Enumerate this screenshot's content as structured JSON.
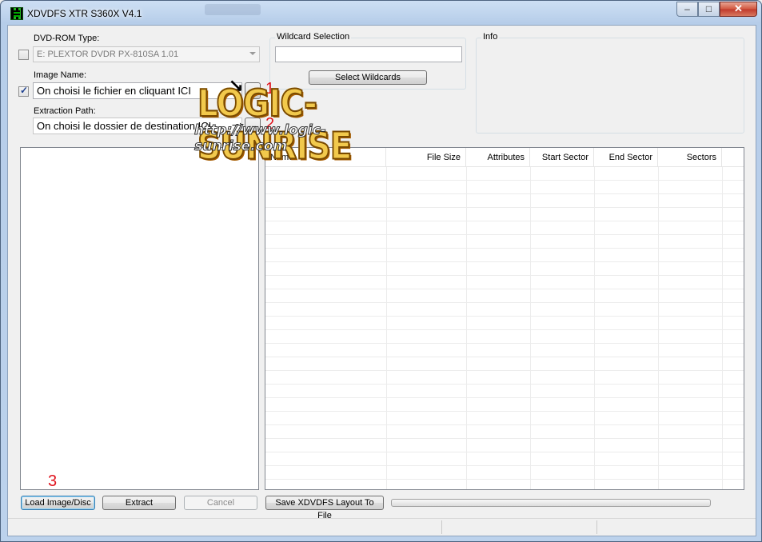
{
  "window": {
    "title": "XDVDFS XTR S360X V4.1",
    "controls": {
      "minimize": "–",
      "maximize": "□",
      "close": "✕"
    }
  },
  "dvd": {
    "label": "DVD-ROM Type:",
    "checked": false,
    "selected": "E: PLEXTOR DVDR PX-810SA 1.01"
  },
  "image": {
    "label": "Image Name:",
    "checked": true,
    "value": "On choisi le fichier en cliquant ICI",
    "browse_label": "..."
  },
  "extraction": {
    "label": "Extraction Path:",
    "value": "On choisi le dossier de destination ICI",
    "browse_label": "..."
  },
  "wildcard": {
    "title": "Wildcard Selection",
    "value": "",
    "button": "Select Wildcards"
  },
  "info": {
    "title": "Info"
  },
  "file_list": {
    "columns": [
      "Name",
      "File Size",
      "Attributes",
      "Start Sector",
      "End Sector",
      "Sectors"
    ],
    "rows": []
  },
  "buttons": {
    "load": "Load Image/Disc",
    "extract": "Extract",
    "cancel": "Cancel",
    "save_layout": "Save XDVDFS Layout To File"
  },
  "progress": {
    "value": 0
  },
  "markers": {
    "one": "1",
    "two": "2",
    "three": "3"
  },
  "watermark": {
    "logo": "LOGIC-SUNRISE",
    "url": "http://www.logic-sunrise.com"
  },
  "colors": {
    "marker": "#e0141e",
    "accent_blue": "#3c7fb1"
  }
}
